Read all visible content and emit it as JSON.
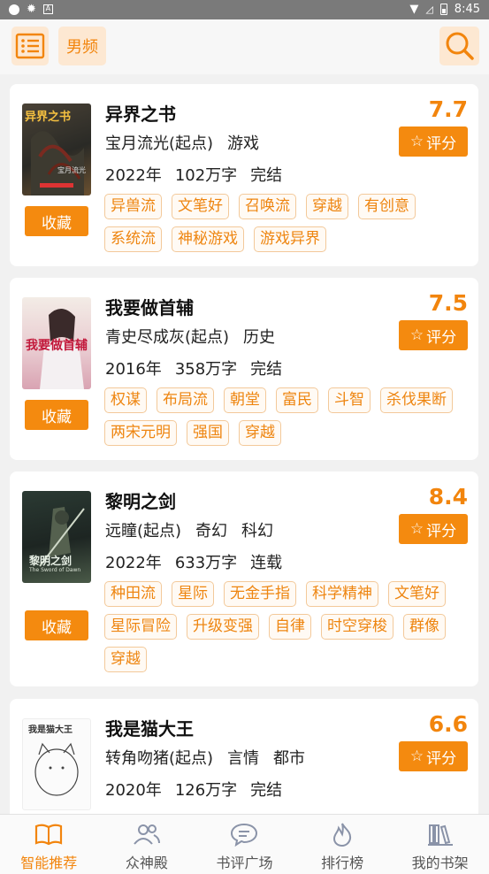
{
  "status_bar": {
    "time": "8:45",
    "app_badge": "A"
  },
  "header": {
    "channel_label": "男频"
  },
  "books": [
    {
      "title": "异界之书",
      "author": "宝月流光(起点)",
      "genres": [
        "游戏"
      ],
      "year": "2022年",
      "words": "102万字",
      "status": "完结",
      "score": "7.7",
      "tags": [
        "异兽流",
        "文笔好",
        "召唤流",
        "穿越",
        "有创意",
        "系统流",
        "神秘游戏",
        "游戏异界"
      ],
      "cover_text": "异界之书",
      "cover_author": "宝月流光"
    },
    {
      "title": "我要做首辅",
      "author": "青史尽成灰(起点)",
      "genres": [
        "历史"
      ],
      "year": "2016年",
      "words": "358万字",
      "status": "完结",
      "score": "7.5",
      "tags": [
        "权谋",
        "布局流",
        "朝堂",
        "富民",
        "斗智",
        "杀伐果断",
        "两宋元明",
        "强国",
        "穿越"
      ],
      "cover_text": "我要做首辅",
      "cover_author": ""
    },
    {
      "title": "黎明之剑",
      "author": "远瞳(起点)",
      "genres": [
        "奇幻",
        "科幻"
      ],
      "year": "2022年",
      "words": "633万字",
      "status": "连载",
      "score": "8.4",
      "tags": [
        "种田流",
        "星际",
        "无金手指",
        "科学精神",
        "文笔好",
        "星际冒险",
        "升级变强",
        "自律",
        "时空穿梭",
        "群像",
        "穿越"
      ],
      "cover_text": "黎明之剑",
      "cover_author": "The Sword of Dawn"
    },
    {
      "title": "我是猫大王",
      "author": "转角吻猪(起点)",
      "genres": [
        "言情",
        "都市"
      ],
      "year": "2020年",
      "words": "126万字",
      "status": "完结",
      "score": "6.6",
      "tags": [
        "",
        "",
        "",
        "",
        ""
      ],
      "cover_text": "我是猫大王",
      "cover_author": ""
    }
  ],
  "labels": {
    "collect": "收藏",
    "rate": "评分"
  },
  "tabs": [
    {
      "label": "智能推荐",
      "icon": "book-icon",
      "active": true
    },
    {
      "label": "众神殿",
      "icon": "people-icon",
      "active": false
    },
    {
      "label": "书评广场",
      "icon": "chat-icon",
      "active": false
    },
    {
      "label": "排行榜",
      "icon": "flame-icon",
      "active": false
    },
    {
      "label": "我的书架",
      "icon": "bookshelf-icon",
      "active": false
    }
  ],
  "colors": {
    "accent": "#f48a0f",
    "accent_light": "#fde8d2",
    "tag_border": "#f3c99a"
  }
}
